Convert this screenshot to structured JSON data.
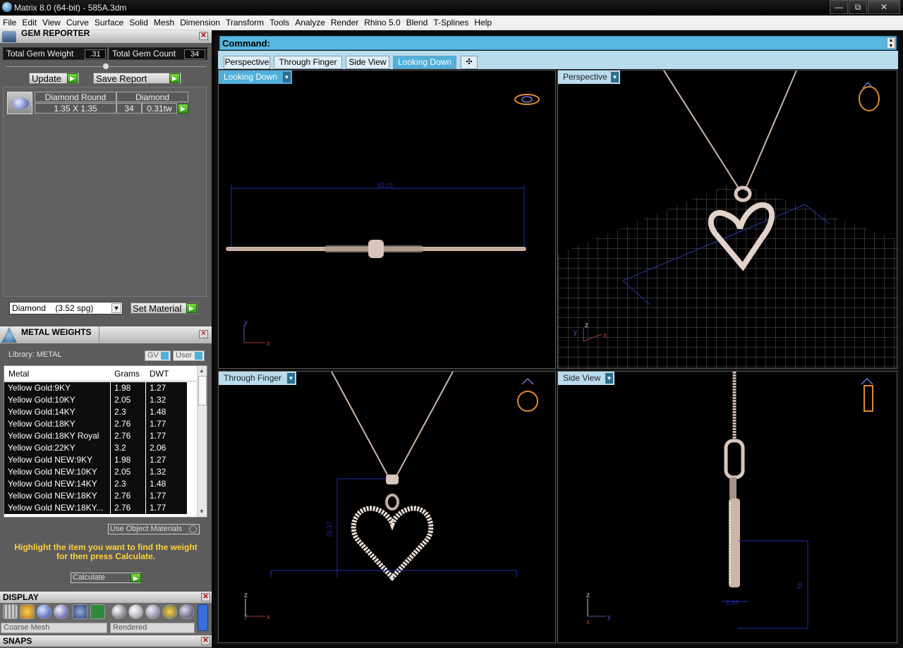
{
  "titlebar": {
    "title": "Matrix 8.0 (64-bit) - 585A.3dm",
    "min": "—",
    "max": "⧉",
    "close": "✕"
  },
  "menu": [
    "File",
    "Edit",
    "View",
    "Curve",
    "Surface",
    "Solid",
    "Mesh",
    "Dimension",
    "Transform",
    "Tools",
    "Analyze",
    "Render",
    "Rhino 5.0",
    "Blend",
    "T-Splines",
    "Help"
  ],
  "gem_reporter": {
    "title": "GEM REPORTER",
    "total_weight_label": "Total Gem Weight",
    "total_weight_value": ".31",
    "total_count_label": "Total Gem Count",
    "total_count_value": "34",
    "update_label": "Update",
    "save_report_label": "Save Report",
    "gem": {
      "shape": "Diamond Round",
      "material": "Diamond",
      "size": "1.35 X 1.35",
      "count": "34",
      "weight": "0.31tw"
    },
    "material_select": "Diamond    (3.52 spg)",
    "set_material_label": "Set Material"
  },
  "metal_weights": {
    "title": "METAL WEIGHTS",
    "library_label": "Library: METAL",
    "gv_label": "GV",
    "user_label": "User",
    "columns": [
      "Metal",
      "Grams",
      "DWT"
    ],
    "rows": [
      [
        "Yellow Gold:9KY",
        "1.98",
        "1.27"
      ],
      [
        "Yellow Gold:10KY",
        "2.05",
        "1.32"
      ],
      [
        "Yellow Gold:14KY",
        "2.3",
        "1.48"
      ],
      [
        "Yellow Gold:18KY",
        "2.76",
        "1.77"
      ],
      [
        "Yellow Gold:18KY Royal",
        "2.76",
        "1.77"
      ],
      [
        "Yellow Gold:22KY",
        "3.2",
        "2.06"
      ],
      [
        "Yellow Gold NEW:9KY",
        "1.98",
        "1.27"
      ],
      [
        "Yellow Gold NEW:10KY",
        "2.05",
        "1.32"
      ],
      [
        "Yellow Gold NEW:14KY",
        "2.3",
        "1.48"
      ],
      [
        "Yellow Gold NEW:18KY",
        "2.76",
        "1.77"
      ],
      [
        "Yellow Gold NEW:18KY...",
        "2.76",
        "1.77"
      ]
    ],
    "use_object_materials": "Use Object Materials",
    "hint": "Highlight the item you want to find the weight for then press Calculate.",
    "calculate_label": "Calculate"
  },
  "display": {
    "title": "DISPLAY",
    "mesh_select": "Coarse Mesh",
    "render_select": "Rendered"
  },
  "snaps": {
    "title": "SNAPS"
  },
  "command": {
    "label": "Command:"
  },
  "tabs": [
    "Perspective",
    "Through Finger",
    "Side View",
    "Looking Down"
  ],
  "active_tab": "Looking Down",
  "add_tab": "✣",
  "viewports": {
    "top_left": {
      "label": "Looking Down",
      "dim": "55.01"
    },
    "top_right": {
      "label": "Perspective"
    },
    "bottom_left": {
      "label": "Through Finger",
      "dim": "22.37"
    },
    "bottom_right": {
      "label": "Side View",
      "dim1": "2.04",
      "dim2": "55"
    }
  },
  "axes": {
    "x": "x",
    "y": "y",
    "z": "z"
  }
}
